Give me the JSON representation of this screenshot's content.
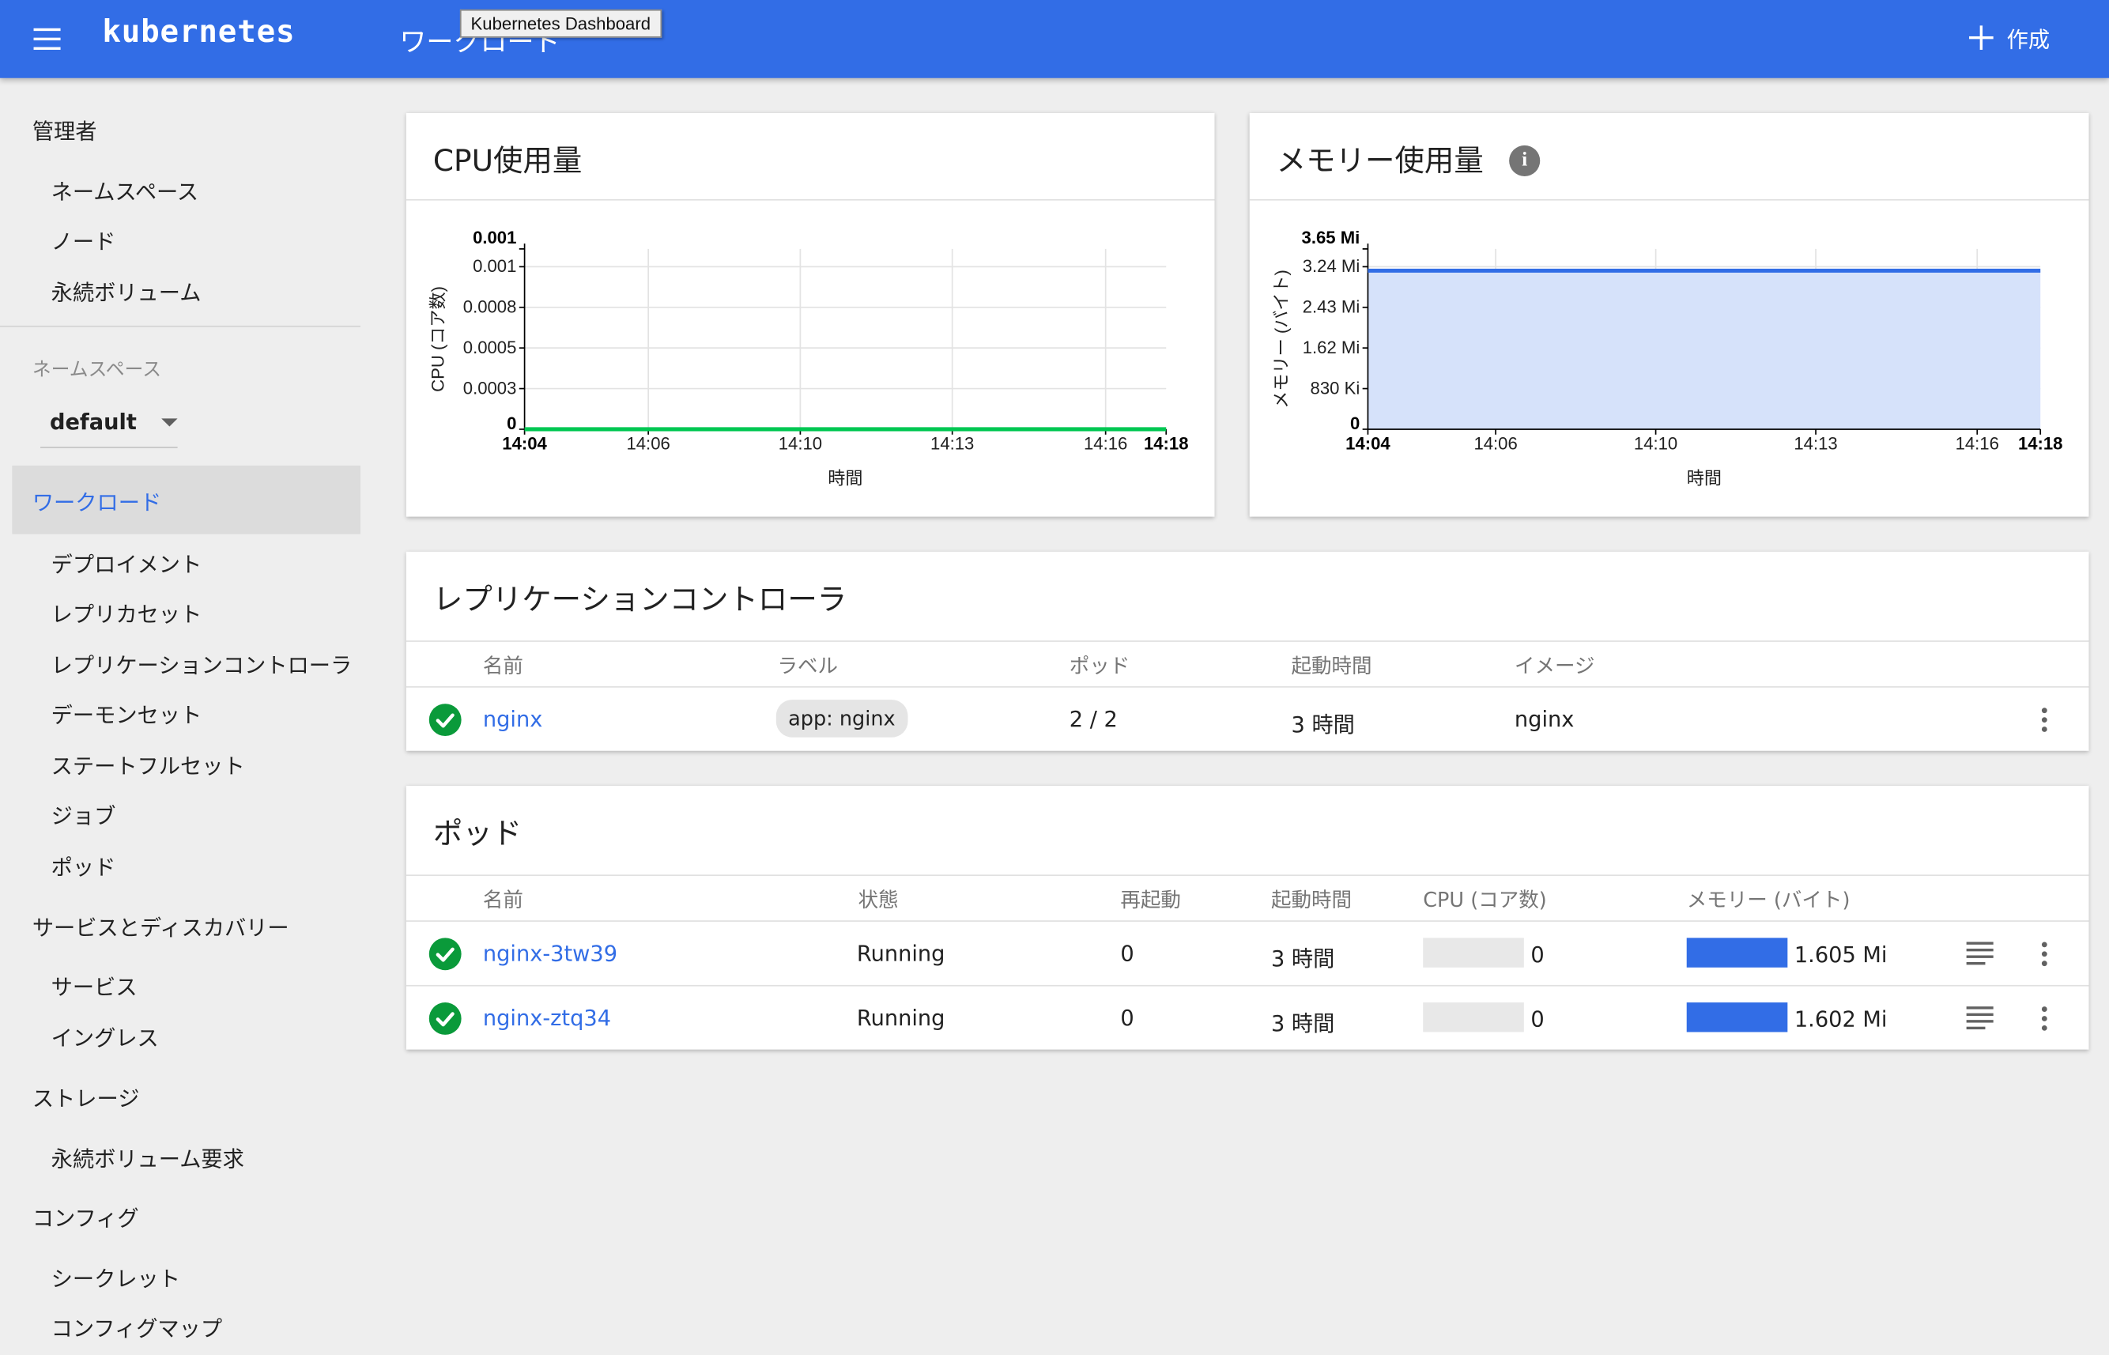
{
  "header": {
    "logo": "kubernetes",
    "page_title": "ワークロード",
    "tooltip": "Kubernetes Dashboard",
    "create_label": "作成"
  },
  "sidebar": {
    "admin_heading": "管理者",
    "admin_items": [
      "ネームスペース",
      "ノード",
      "永続ボリューム"
    ],
    "namespace_label": "ネームスペース",
    "namespace_value": "default",
    "workloads_label": "ワークロード",
    "workload_items": [
      "デプロイメント",
      "レプリカセット",
      "レプリケーションコントローラ",
      "デーモンセット",
      "ステートフルセット",
      "ジョブ",
      "ポッド"
    ],
    "discovery_heading": "サービスとディスカバリー",
    "discovery_items": [
      "サービス",
      "イングレス"
    ],
    "storage_heading": "ストレージ",
    "storage_items": [
      "永続ボリューム要求"
    ],
    "config_heading": "コンフィグ",
    "config_items": [
      "シークレット",
      "コンフィグマップ"
    ]
  },
  "cpu_card": {
    "title": "CPU使用量"
  },
  "memory_card": {
    "title": "メモリー使用量",
    "info_icon": "info-icon"
  },
  "chart_data": [
    {
      "type": "line",
      "title": "CPU使用量",
      "xlabel": "時間",
      "ylabel": "CPU (コア数)",
      "x_ticks": [
        "14:04",
        "14:06",
        "14:10",
        "14:13",
        "14:16",
        "14:18"
      ],
      "y_ticks": [
        "0",
        "0.0003",
        "0.0005",
        "0.0008",
        "0.001",
        "0.001"
      ],
      "ylim": [
        0,
        0.001
      ],
      "x": [
        "14:04",
        "14:18"
      ],
      "series": [
        {
          "values": [
            0,
            0
          ],
          "color": "#00c752"
        }
      ],
      "grid": true
    },
    {
      "type": "area",
      "title": "メモリー使用量",
      "xlabel": "時間",
      "ylabel": "メモリー (バイト)",
      "x_ticks": [
        "14:04",
        "14:06",
        "14:10",
        "14:13",
        "14:16",
        "14:18"
      ],
      "y_ticks": [
        "0",
        "830 Ki",
        "1.62 Mi",
        "2.43 Mi",
        "3.24 Mi",
        "3.65 Mi"
      ],
      "ylim": [
        0,
        3.65
      ],
      "unit": "Mi",
      "x": [
        "14:04",
        "14:18"
      ],
      "series": [
        {
          "values": [
            3.21,
            3.21
          ],
          "color": "#326de6",
          "fill": "#d6e2fa"
        }
      ],
      "grid": true
    }
  ],
  "rc_card": {
    "title": "レプリケーションコントローラ",
    "columns": [
      "名前",
      "ラベル",
      "ポッド",
      "起動時間",
      "イメージ"
    ],
    "rows": [
      {
        "name": "nginx",
        "label": "app: nginx",
        "pods": "2 / 2",
        "age": "3 時間",
        "image": "nginx",
        "status": "ok"
      }
    ]
  },
  "pods_card": {
    "title": "ポッド",
    "columns": [
      "名前",
      "状態",
      "再起動",
      "起動時間",
      "CPU (コア数)",
      "メモリー (バイト)"
    ],
    "rows": [
      {
        "name": "nginx-3tw39",
        "status": "Running",
        "restarts": "0",
        "age": "3 時間",
        "cpu": "0",
        "cpu_fraction": 0,
        "memory": "1.605 Mi",
        "memory_fraction": 1.0
      },
      {
        "name": "nginx-ztq34",
        "status": "Running",
        "restarts": "0",
        "age": "3 時間",
        "cpu": "0",
        "cpu_fraction": 0,
        "memory": "1.602 Mi",
        "memory_fraction": 1.0
      }
    ]
  },
  "colors": {
    "primary": "#326de6",
    "success": "#0a9a3a",
    "cpu_line": "#00c752"
  }
}
